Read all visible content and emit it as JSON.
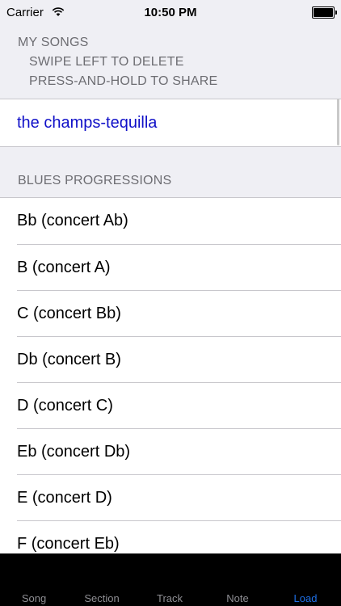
{
  "status": {
    "carrier": "Carrier",
    "time": "10:50 PM"
  },
  "my_songs": {
    "title": "MY SONGS",
    "hint_delete": "SWIPE LEFT TO DELETE",
    "hint_share": "PRESS-AND-HOLD TO SHARE",
    "items": [
      "the champs-tequilla"
    ]
  },
  "blues": {
    "title": "BLUES PROGRESSIONS",
    "items": [
      "Bb (concert Ab)",
      "B (concert A)",
      "C (concert Bb)",
      "Db (concert B)",
      "D (concert C)",
      "Eb (concert Db)",
      "E (concert D)",
      "F (concert Eb)"
    ]
  },
  "tabs": [
    "Song",
    "Section",
    "Track",
    "Note",
    "Load"
  ],
  "active_tab": "Load",
  "colors": {
    "song_link": "#1010c8",
    "active_tab": "#1e6fe6",
    "tab_bar_bg": "#000000"
  }
}
